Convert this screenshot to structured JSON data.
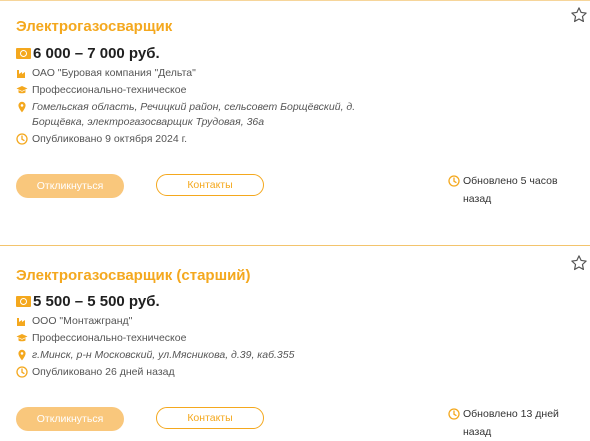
{
  "vacancies": [
    {
      "title": "Электрогазосварщик",
      "salary": "6 000 – 7 000 руб.",
      "company": "ОАО \"Буровая компания \"Дельта\"",
      "education": "Профессионально-техническое",
      "address": "Гомельская область, Речицкий район, сельсовет Борщёвский, д. Борщёвка, электрогазосварщик Трудовая, 36а",
      "published": "Опубликовано 9 октября 2024 г.",
      "apply_label": "Откликнуться",
      "contacts_label": "Контакты",
      "updated": "Обновлено 5 часов назад"
    },
    {
      "title": "Электрогазосварщик (старший)",
      "salary": "5 500 – 5 500 руб.",
      "company": "ООО \"Монтажгранд\"",
      "education": "Профессионально-техническое",
      "address": "г.Минск, р-н Московский, ул.Мясникова, д.39, каб.355",
      "published": "Опубликовано 26 дней назад",
      "apply_label": "Откликнуться",
      "contacts_label": "Контакты",
      "updated": "Обновлено 13 дней назад"
    }
  ],
  "colors": {
    "accent": "#f4a81e",
    "button_fill": "#f9c77c",
    "star": "#555555"
  },
  "icons": {
    "favorite": "star-icon",
    "salary": "money-icon",
    "company": "factory-icon",
    "education": "graduation-cap-icon",
    "location": "location-pin-icon",
    "time": "clock-icon"
  }
}
